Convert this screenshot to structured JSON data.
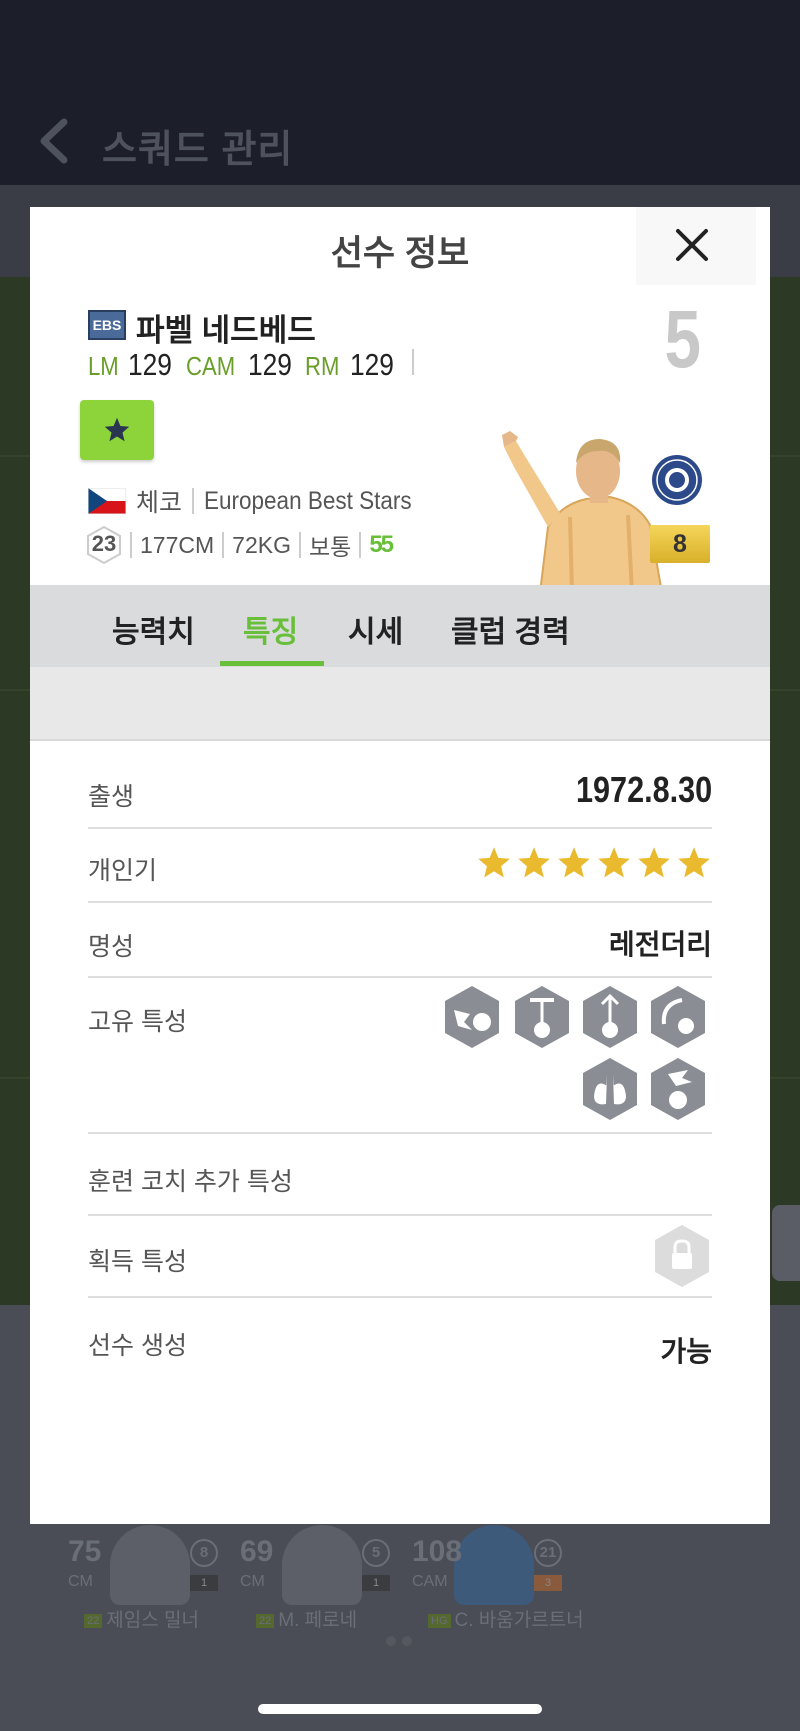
{
  "background": {
    "title": "스쿼드 관리",
    "players": [
      {
        "ovr": "75",
        "pos": "CM",
        "num": "8",
        "level": "1",
        "season": "22",
        "name": "제임스 밀너"
      },
      {
        "ovr": "69",
        "pos": "CM",
        "num": "5",
        "level": "1",
        "season": "22",
        "name": "M. 페로네"
      },
      {
        "ovr": "108",
        "pos": "CAM",
        "num": "21",
        "level": "3",
        "season": "HG",
        "name": "C. 바움가르트너"
      }
    ]
  },
  "modal": {
    "title": "선수 정보",
    "close_icon": "close-icon"
  },
  "player": {
    "club_badge": "EBS",
    "name": "파벨 네드베드",
    "positions": [
      {
        "pos": "LM",
        "val": "129"
      },
      {
        "pos": "CAM",
        "val": "129"
      },
      {
        "pos": "RM",
        "val": "129"
      }
    ],
    "back_number": "5",
    "nation": "체코",
    "season": "European Best Stars",
    "age": "23",
    "height": "177CM",
    "weight": "72KG",
    "body": "보통",
    "foot": "55",
    "level": "8"
  },
  "tabs": [
    "능력치",
    "특징",
    "시세",
    "클럽 경력"
  ],
  "active_tab": "특징",
  "info": {
    "birth_label": "출생",
    "birth_value": "1972.8.30",
    "popularity_label": "개인기",
    "popularity_stars": 6,
    "fame_label": "명성",
    "fame_value": "레전더리",
    "traits_label": "고유 특성",
    "traits": [
      "flair-trait-icon",
      "long-shot-trait-icon",
      "power-header-trait-icon",
      "outside-foot-trait-icon",
      "stamina-trait-icon",
      "finesse-trait-icon"
    ],
    "coach_label": "훈련 코치 추가 특성",
    "acquired_label": "획득 특성",
    "acquired_icon": "lock-icon",
    "create_label": "선수 생성",
    "create_value": "가능"
  },
  "colors": {
    "accent": "#6abf3a",
    "star": "#e9b92e",
    "trait_hex": "#8a8d94"
  }
}
